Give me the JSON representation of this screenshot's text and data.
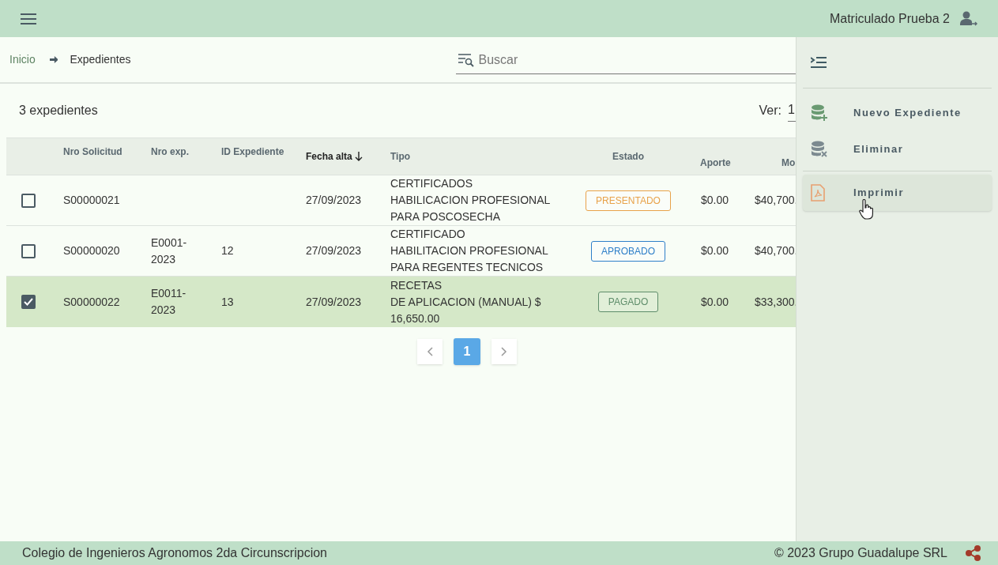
{
  "header": {
    "user": "Matriculado Prueba 2"
  },
  "breadcrumb": [
    "Inicio",
    "Expedientes"
  ],
  "search": {
    "placeholder": "Buscar"
  },
  "count": "3 expedientes",
  "ver": {
    "label": "Ver:",
    "value": "1"
  },
  "table": {
    "columns": [
      {
        "label": "Nro Solicitud",
        "sorted": false
      },
      {
        "label": "Nro exp.",
        "sorted": false
      },
      {
        "label": "ID Expediente",
        "sorted": false
      },
      {
        "label": "Fecha alta",
        "sorted": true
      },
      {
        "label": "Tipo",
        "sorted": false
      },
      {
        "label": "Estado",
        "sorted": false
      },
      {
        "label": "Aporte",
        "sorted": false
      },
      {
        "label": "Mo",
        "sorted": false
      }
    ],
    "rows": [
      {
        "checked": false,
        "cells": [
          "S00000021",
          "",
          "",
          "27/09/2023",
          [
            "CERTIFICADOS",
            "HABILICACION PROFESIONAL",
            "PARA POSCOSECHA"
          ]
        ],
        "estado": {
          "label": "PRESENTADO",
          "color": "#e8a24a"
        },
        "aporte": "$0.00",
        "column_8": "$40,700."
      },
      {
        "checked": false,
        "cells": [
          "S00000020",
          "E0001-2023",
          "12",
          "27/09/2023",
          [
            "CERTIFICADO",
            "HABILITACION PROFESIONAL",
            "PARA REGENTES TECNICOS"
          ]
        ],
        "estado": {
          "label": "APROBADO",
          "color": "#2f7fc9"
        },
        "aporte": "$0.00",
        "column_8": "$40,700."
      },
      {
        "checked": true,
        "cells": [
          "S00000022",
          "E0011-2023",
          "13",
          "27/09/2023",
          [
            "RECETAS",
            "DE APLICACION (MANUAL) $",
            "16,650.00"
          ]
        ],
        "estado": {
          "label": "PAGADO",
          "color": "#5e8d6a"
        },
        "aporte": "$0.00",
        "column_8": "$33,300."
      }
    ]
  },
  "pagination": {
    "pages": [
      {
        "label": "1",
        "selected": true
      }
    ]
  },
  "panel": {
    "items": [
      {
        "kind": "add",
        "label": "Nuevo Expediente",
        "highlighted": false
      },
      {
        "kind": "delete",
        "label": "Eliminar",
        "highlighted": false
      },
      {
        "kind": "pdf",
        "label": "Imprimir",
        "highlighted": true
      }
    ]
  },
  "footer": {
    "left": "Colegio de Ingenieros Agronomos 2da Circunscripcion",
    "right": "© 2023 Grupo Guadalupe SRL"
  }
}
